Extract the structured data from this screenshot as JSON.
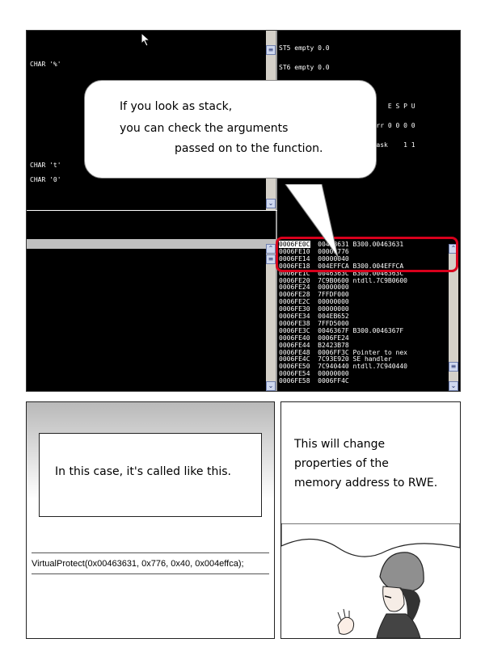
{
  "panel1": {
    "fpu_lines": [
      "ST5 empty 0.0",
      "ST6 empty 0.0",
      "ST7 empty 0.0",
      "               3 2 1 0      E S P U",
      "FST 0000  Cond 0 0 0 0  Err 0 0 0 0",
      "FCW 027F  Prec NEAR,53  Mask    1 1"
    ],
    "char_labels": [
      "CHAR '%'",
      "CHAR 't'",
      "CHAR '0'"
    ],
    "stack_rows": [
      {
        "addr": "0006FE0C",
        "value": "00463631",
        "comment": "B300.00463631"
      },
      {
        "addr": "0006FE10",
        "value": "00000776",
        "comment": ""
      },
      {
        "addr": "0006FE14",
        "value": "00000040",
        "comment": ""
      },
      {
        "addr": "0006FE18",
        "value": "004EFFCA",
        "comment": "B300.004EFFCA"
      },
      {
        "addr": "0006FE1C",
        "value": "0046363C",
        "comment": "B300.0046363C"
      },
      {
        "addr": "0006FE20",
        "value": "7C9B0600",
        "comment": "ntdll.7C9B0600"
      },
      {
        "addr": "0006FE24",
        "value": "00000000",
        "comment": ""
      },
      {
        "addr": "0006FE28",
        "value": "7FFDF000",
        "comment": ""
      },
      {
        "addr": "0006FE2C",
        "value": "00000000",
        "comment": ""
      },
      {
        "addr": "0006FE30",
        "value": "00000000",
        "comment": ""
      },
      {
        "addr": "0006FE34",
        "value": "004EB652",
        "comment": ""
      },
      {
        "addr": "0006FE38",
        "value": "7FFD5000",
        "comment": ""
      },
      {
        "addr": "0006FE3C",
        "value": "0046367F",
        "comment": "B300.0046367F"
      },
      {
        "addr": "0006FE40",
        "value": "0006FE24",
        "comment": ""
      },
      {
        "addr": "0006FE44",
        "value": "B2423B78",
        "comment": ""
      },
      {
        "addr": "0006FE48",
        "value": "0006FF3C",
        "comment": "Pointer to nex"
      },
      {
        "addr": "0006FE4C",
        "value": "7C93E920",
        "comment": "SE handler"
      },
      {
        "addr": "0006FE50",
        "value": "7C940440",
        "comment": "ntdll.7C940440"
      },
      {
        "addr": "0006FE54",
        "value": "00000000",
        "comment": ""
      },
      {
        "addr": "0006FE58",
        "value": "0006FF4C",
        "comment": ""
      }
    ],
    "bubble_lines": [
      "If you look as stack,",
      "you can check the arguments",
      "passed on to the function."
    ]
  },
  "panel2": {
    "caption": "In this case, it's called like this.",
    "code": "VirtualProtect(0x00463631, 0x776, 0x40, 0x004effca);"
  },
  "panel3": {
    "lines": [
      "This will change",
      "properties of the",
      "memory address to RWE."
    ]
  }
}
